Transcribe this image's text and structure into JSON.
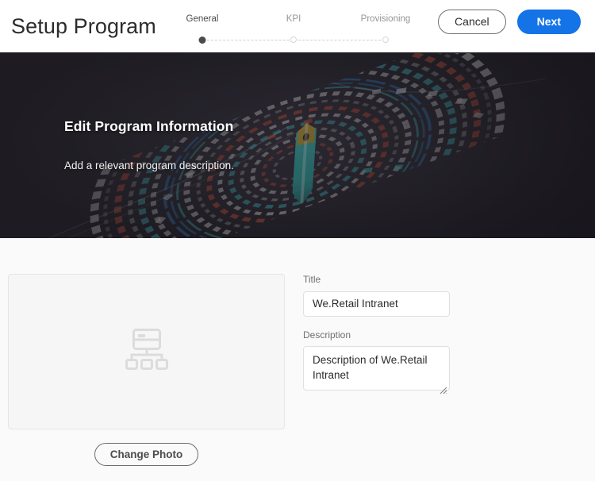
{
  "header": {
    "title": "Setup Program",
    "cancel_label": "Cancel",
    "next_label": "Next",
    "accent_color": "#1473E6"
  },
  "steps": [
    {
      "label": "General",
      "state": "active"
    },
    {
      "label": "KPI",
      "state": "inactive"
    },
    {
      "label": "Provisioning",
      "state": "inactive"
    }
  ],
  "hero": {
    "title": "Edit Program Information",
    "subtitle": "Add a relevant program description.",
    "background_color": "#262329"
  },
  "form": {
    "photo": {
      "placeholder_icon": "sitemap-icon",
      "change_photo_label": "Change Photo"
    },
    "title_field": {
      "label": "Title",
      "value": "We.Retail Intranet",
      "placeholder": "Title"
    },
    "description_field": {
      "label": "Description",
      "value": "Description of We.Retail Intranet",
      "placeholder": "Description"
    }
  }
}
